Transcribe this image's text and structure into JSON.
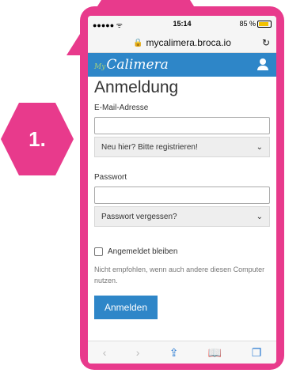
{
  "badge": {
    "label": "1."
  },
  "status": {
    "carrier": "●●●●● ᯤ",
    "time": "15:14",
    "battery": "85 %"
  },
  "browser": {
    "url": "mycalimera.broca.io"
  },
  "app": {
    "logo_prefix": "My",
    "logo": "Calimera"
  },
  "form": {
    "title": "Anmeldung",
    "email_label": "E-Mail-Adresse",
    "register_link": "Neu hier? Bitte registrieren!",
    "password_label": "Passwort",
    "forgot_link": "Passwort vergessen?",
    "remember_label": "Angemeldet bleiben",
    "hint": "Nicht empfohlen, wenn auch andere diesen Computer nutzen.",
    "submit": "Anmelden"
  },
  "icons": {
    "lock": "lock-icon",
    "reload": "reload-icon",
    "user": "user-icon",
    "chevron": "chevron-down-icon",
    "back": "back-icon",
    "forward": "forward-icon",
    "share": "share-icon",
    "bookmarks": "bookmarks-icon",
    "tabs": "tabs-icon"
  },
  "colors": {
    "accent": "#e83a8c",
    "brand_blue": "#2e86c8"
  }
}
